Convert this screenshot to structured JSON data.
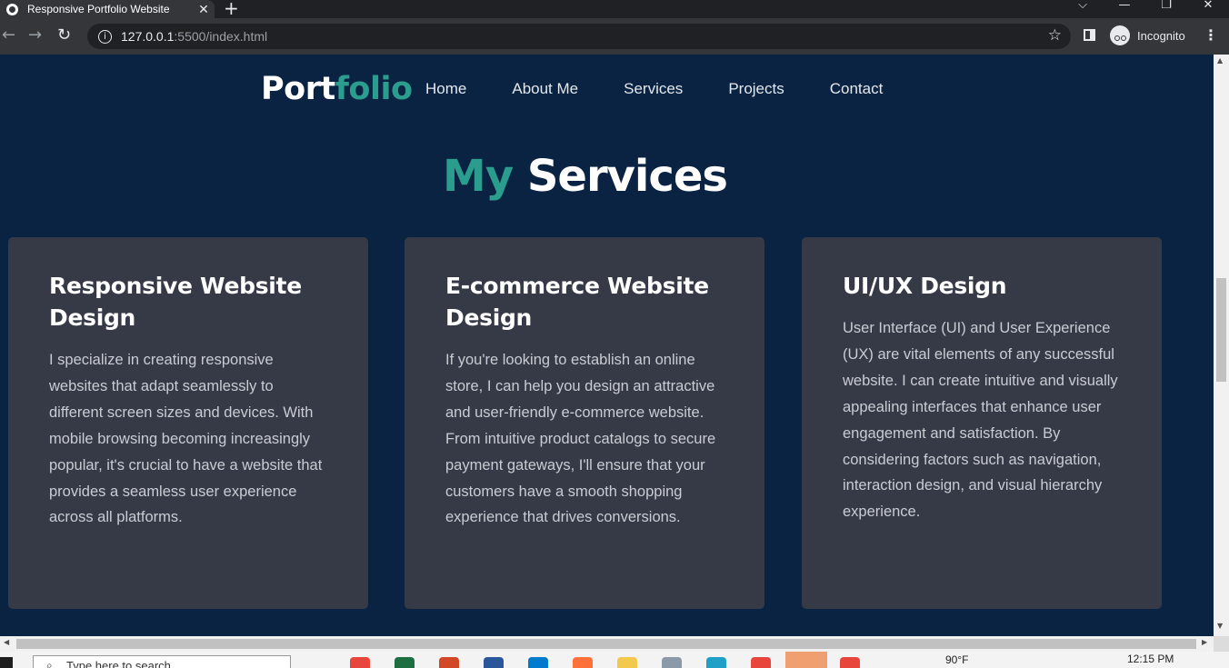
{
  "browser": {
    "tab_title": "Responsive Portfolio Website",
    "tab_close": "✕",
    "new_tab": "+",
    "url_host": "127.0.0.1",
    "url_rest": ":5500/index.html",
    "incognito_label": "Incognito",
    "window_controls": [
      "⌵",
      "—",
      "❐",
      "✕"
    ]
  },
  "site": {
    "logo_main": "Port",
    "logo_accent": "folio",
    "nav": [
      "Home",
      "About Me",
      "Services",
      "Projects",
      "Contact"
    ],
    "section_title_accent": "My",
    "section_title_main": " Services",
    "accent_color": "#2a9d8f",
    "background_color": "#0a2342",
    "card_color": "#363a47"
  },
  "services": [
    {
      "title": "Responsive Website Design",
      "body": "I specialize in creating responsive websites that adapt seamlessly to different screen sizes and devices. With mobile browsing becoming increasingly popular, it's crucial to have a website that provides a seamless user experience across all platforms."
    },
    {
      "title": "E-commerce Website Design",
      "body": "If you're looking to establish an online store, I can help you design an attractive and user-friendly e-commerce website. From intuitive product catalogs to secure payment gateways, I'll ensure that your customers have a smooth shopping experience that drives conversions."
    },
    {
      "title": "UI/UX Design",
      "body": "User Interface (UI) and User Experience (UX) are vital elements of any successful website. I can create intuitive and visually appealing interfaces that enhance user engagement and satisfaction. By considering factors such as navigation, interaction design, and visual hierarchy experience."
    }
  ],
  "taskbar": {
    "search_placeholder": "Type here to search",
    "weather": "90°F",
    "time": "12:15 PM"
  }
}
